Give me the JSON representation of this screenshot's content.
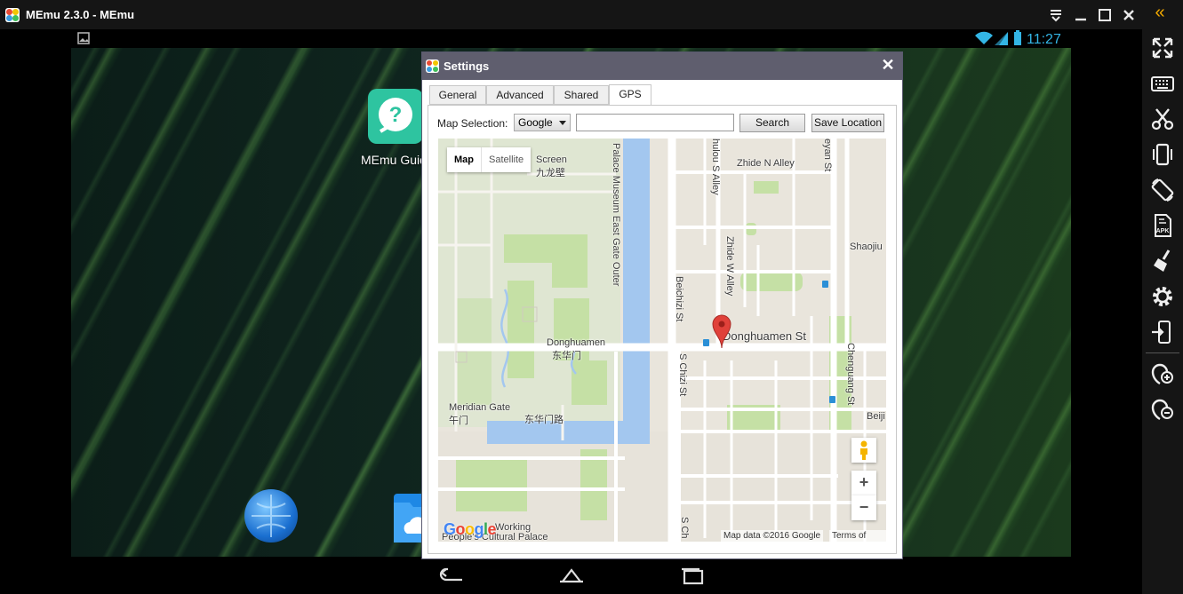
{
  "window": {
    "title": "MEmu 2.3.0 - MEmu",
    "controls": [
      "menu-icon",
      "minimize-icon",
      "maximize-icon",
      "close-icon"
    ],
    "collapse_glyph": "«"
  },
  "statusbar": {
    "time": "11:27"
  },
  "desktop": {
    "app_label": "MEmu Guid"
  },
  "settings": {
    "title": "Settings",
    "close_glyph": "✕",
    "tabs": [
      {
        "label": "General",
        "active": false
      },
      {
        "label": "Advanced",
        "active": false
      },
      {
        "label": "Shared",
        "active": false
      },
      {
        "label": "GPS",
        "active": true
      }
    ],
    "map_selection_label": "Map Selection:",
    "map_selection_value": "Google",
    "search_value": "",
    "search_button": "Search",
    "save_location_button": "Save Location",
    "map": {
      "type_map": "Map",
      "type_satellite": "Satellite",
      "labels": {
        "screen": "Screen",
        "jiulongbi": "九龙壁",
        "palace_museum_east": "Palace Museum East Gate Outer",
        "beichizi": "Beichizi St",
        "zhide_n": "Zhide N Alley",
        "zhide_w": "Zhide W Alley",
        "hulou": "hulou S Alley",
        "yan_st": "eyan St",
        "shaojiu": "Shaojiu",
        "donghuamen": "Donghuamen",
        "donghuamen_cn": "东华门",
        "donghuamen_st": "Donghuamen St",
        "s_chizi": "S Chizi St",
        "chenguang": "Chenguang St",
        "beiji": "Beiji",
        "meridian": "Meridian Gate",
        "wumen": "午门",
        "donghuamen_road": "东华门路",
        "working_people": "Working",
        "cultural_palace": "People's Cultural Palace",
        "s_ch": "S Ch"
      },
      "google": "Google",
      "map_data": "Map data ©2016 Google",
      "terms": "Terms of Use",
      "zoom_in": "+",
      "zoom_out": "−"
    }
  },
  "sidebar": {
    "icons": [
      "fullscreen-icon",
      "keyboard-icon",
      "scissors-icon",
      "shake-icon",
      "rotate-icon",
      "apk-install-icon",
      "clean-icon",
      "settings-gear-icon",
      "exit-app-icon",
      "volume-up-icon",
      "volume-down-icon"
    ]
  },
  "colors": {
    "accent_blue": "#33b5e5",
    "water": "#a3c7ef",
    "park": "#c5e0a5",
    "dialog_header": "#5f5e6e",
    "marker": "#e0413a"
  }
}
